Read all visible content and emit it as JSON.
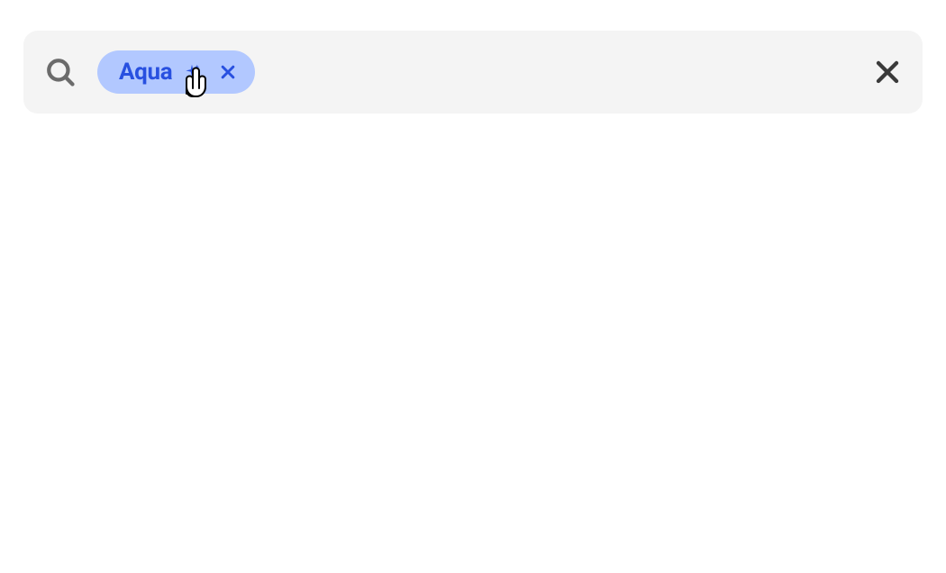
{
  "search": {
    "tags": [
      {
        "label": "Aqua"
      }
    ]
  }
}
